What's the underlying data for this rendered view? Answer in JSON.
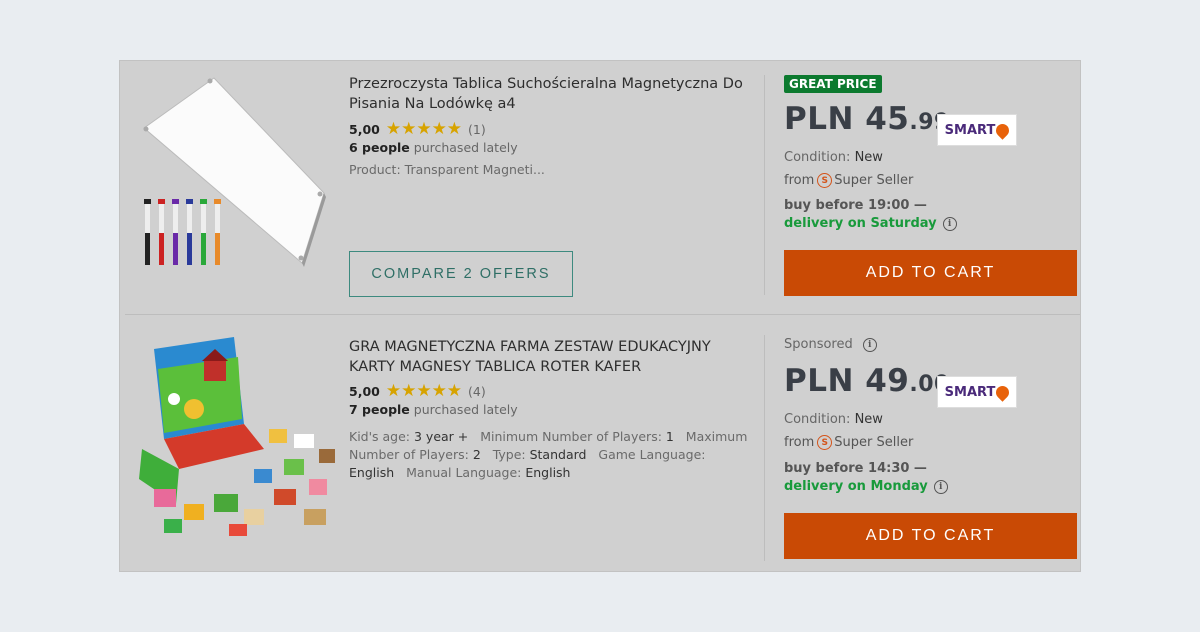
{
  "offers": [
    {
      "title": "Przezroczysta Tablica Suchościeralna Magnetyczna Do Pisania Na Lodówkę a4",
      "rating": "5,00",
      "stars": "★★★★★",
      "rating_count": "(1)",
      "buyers_count": "6 people",
      "buyers_text": " purchased lately",
      "product_line": "Product: Transparent Magneti...",
      "compare_label": "COMPARE 2 OFFERS",
      "badge": "GREAT PRICE",
      "price_main": "PLN 45",
      "price_cents": ".99",
      "smart_label": "SMART",
      "condition_label": "Condition: ",
      "condition_value": "New",
      "from_label": "from",
      "seller_icon": "S",
      "seller_text": "Super Seller",
      "buy_before": "buy before 19:00 —",
      "delivery": "delivery on Saturday",
      "cart_label": "ADD TO CART"
    },
    {
      "title": "GRA MAGNETYCZNA FARMA ZESTAW EDUKACYJNY KARTY MAGNESY TABLICA ROTER KAFER",
      "rating": "5,00",
      "stars": "★★★★★",
      "rating_count": "(4)",
      "buyers_count": "7 people",
      "buyers_text": " purchased lately",
      "params": [
        {
          "label": "Kid's age: ",
          "value": "3 year +"
        },
        {
          "label": "Minimum Number of Players: ",
          "value": "1"
        },
        {
          "label": "Maximum Number of Players: ",
          "value": "2"
        },
        {
          "label": "Type: ",
          "value": "Standard"
        },
        {
          "label": "Game Language: ",
          "value": "English"
        },
        {
          "label": "Manual Language: ",
          "value": "English"
        }
      ],
      "sponsored": "Sponsored",
      "price_main": "PLN 49",
      "price_cents": ".00",
      "smart_label": "SMART",
      "condition_label": "Condition: ",
      "condition_value": "New",
      "from_label": "from",
      "seller_icon": "S",
      "seller_text": "Super Seller",
      "buy_before": "buy before 14:30 —",
      "delivery": "delivery on Monday",
      "cart_label": "ADD TO CART"
    }
  ],
  "info_icon": "i",
  "colors": {
    "accent_button": "#c94a05",
    "great_price": "#0c7a2f",
    "delivery": "#189a3b",
    "compare_border": "#3d8a7f",
    "smart_pin": "#e8620a"
  }
}
